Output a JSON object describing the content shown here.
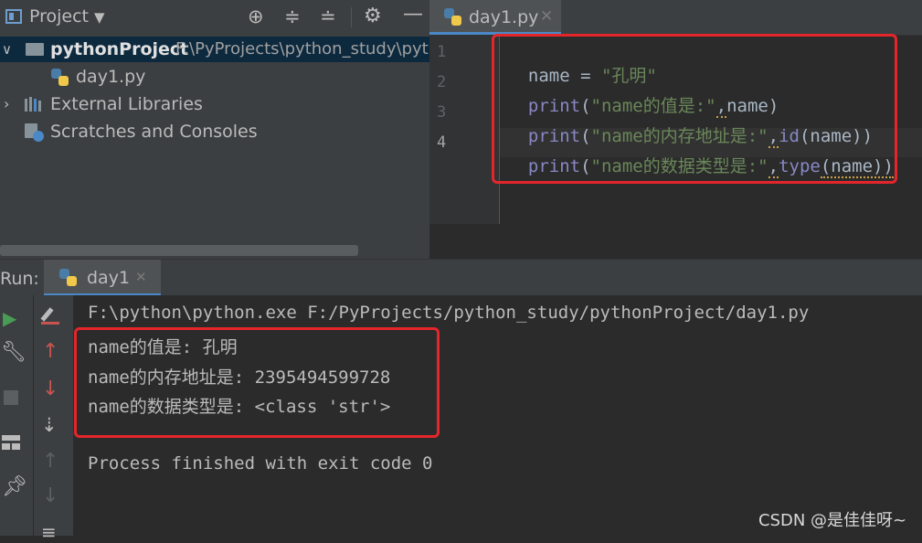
{
  "project_panel": {
    "title": "Project",
    "tree": [
      {
        "label": "pythonProject",
        "path": "F:\\PyProjects\\python_study\\pyth"
      },
      {
        "label": "day1.py"
      },
      {
        "label": "External Libraries"
      },
      {
        "label": "Scratches and Consoles"
      }
    ]
  },
  "editor": {
    "tab_label": "day1.py",
    "line_numbers": [
      "1",
      "2",
      "3",
      "4"
    ],
    "lines": [
      {
        "var": "name",
        "eq": " = ",
        "str": "\"孔明\""
      },
      {
        "fn": "print",
        "open": "(",
        "str": "\"name的值是:\"",
        "comma": ",",
        "arg": "name",
        "close": ")"
      },
      {
        "fn": "print",
        "open": "(",
        "str": "\"name的内存地址是:\"",
        "comma": ",",
        "fn2": "id",
        "arg": "(name))"
      },
      {
        "fn": "print",
        "open": "(",
        "str": "\"name的数据类型是:\"",
        "comma": ",",
        "fn2": "type",
        "arg": "(name))"
      }
    ]
  },
  "run_panel": {
    "label": "Run:",
    "tab_label": "day1",
    "command": "F:\\python\\python.exe F:/PyProjects/python_study/pythonProject/day1.py",
    "output": [
      "name的值是: 孔明",
      "name的内存地址是: 2395494599728",
      "name的数据类型是: <class 'str'>"
    ],
    "exit_message": "Process finished with exit code 0"
  },
  "watermark": "CSDN @是佳佳呀~",
  "colors": {
    "highlight_box": "#e4262b",
    "keyword": "#8888c6",
    "string": "#6a8759",
    "run_green": "#499c54",
    "arrow_red": "#c75450"
  }
}
